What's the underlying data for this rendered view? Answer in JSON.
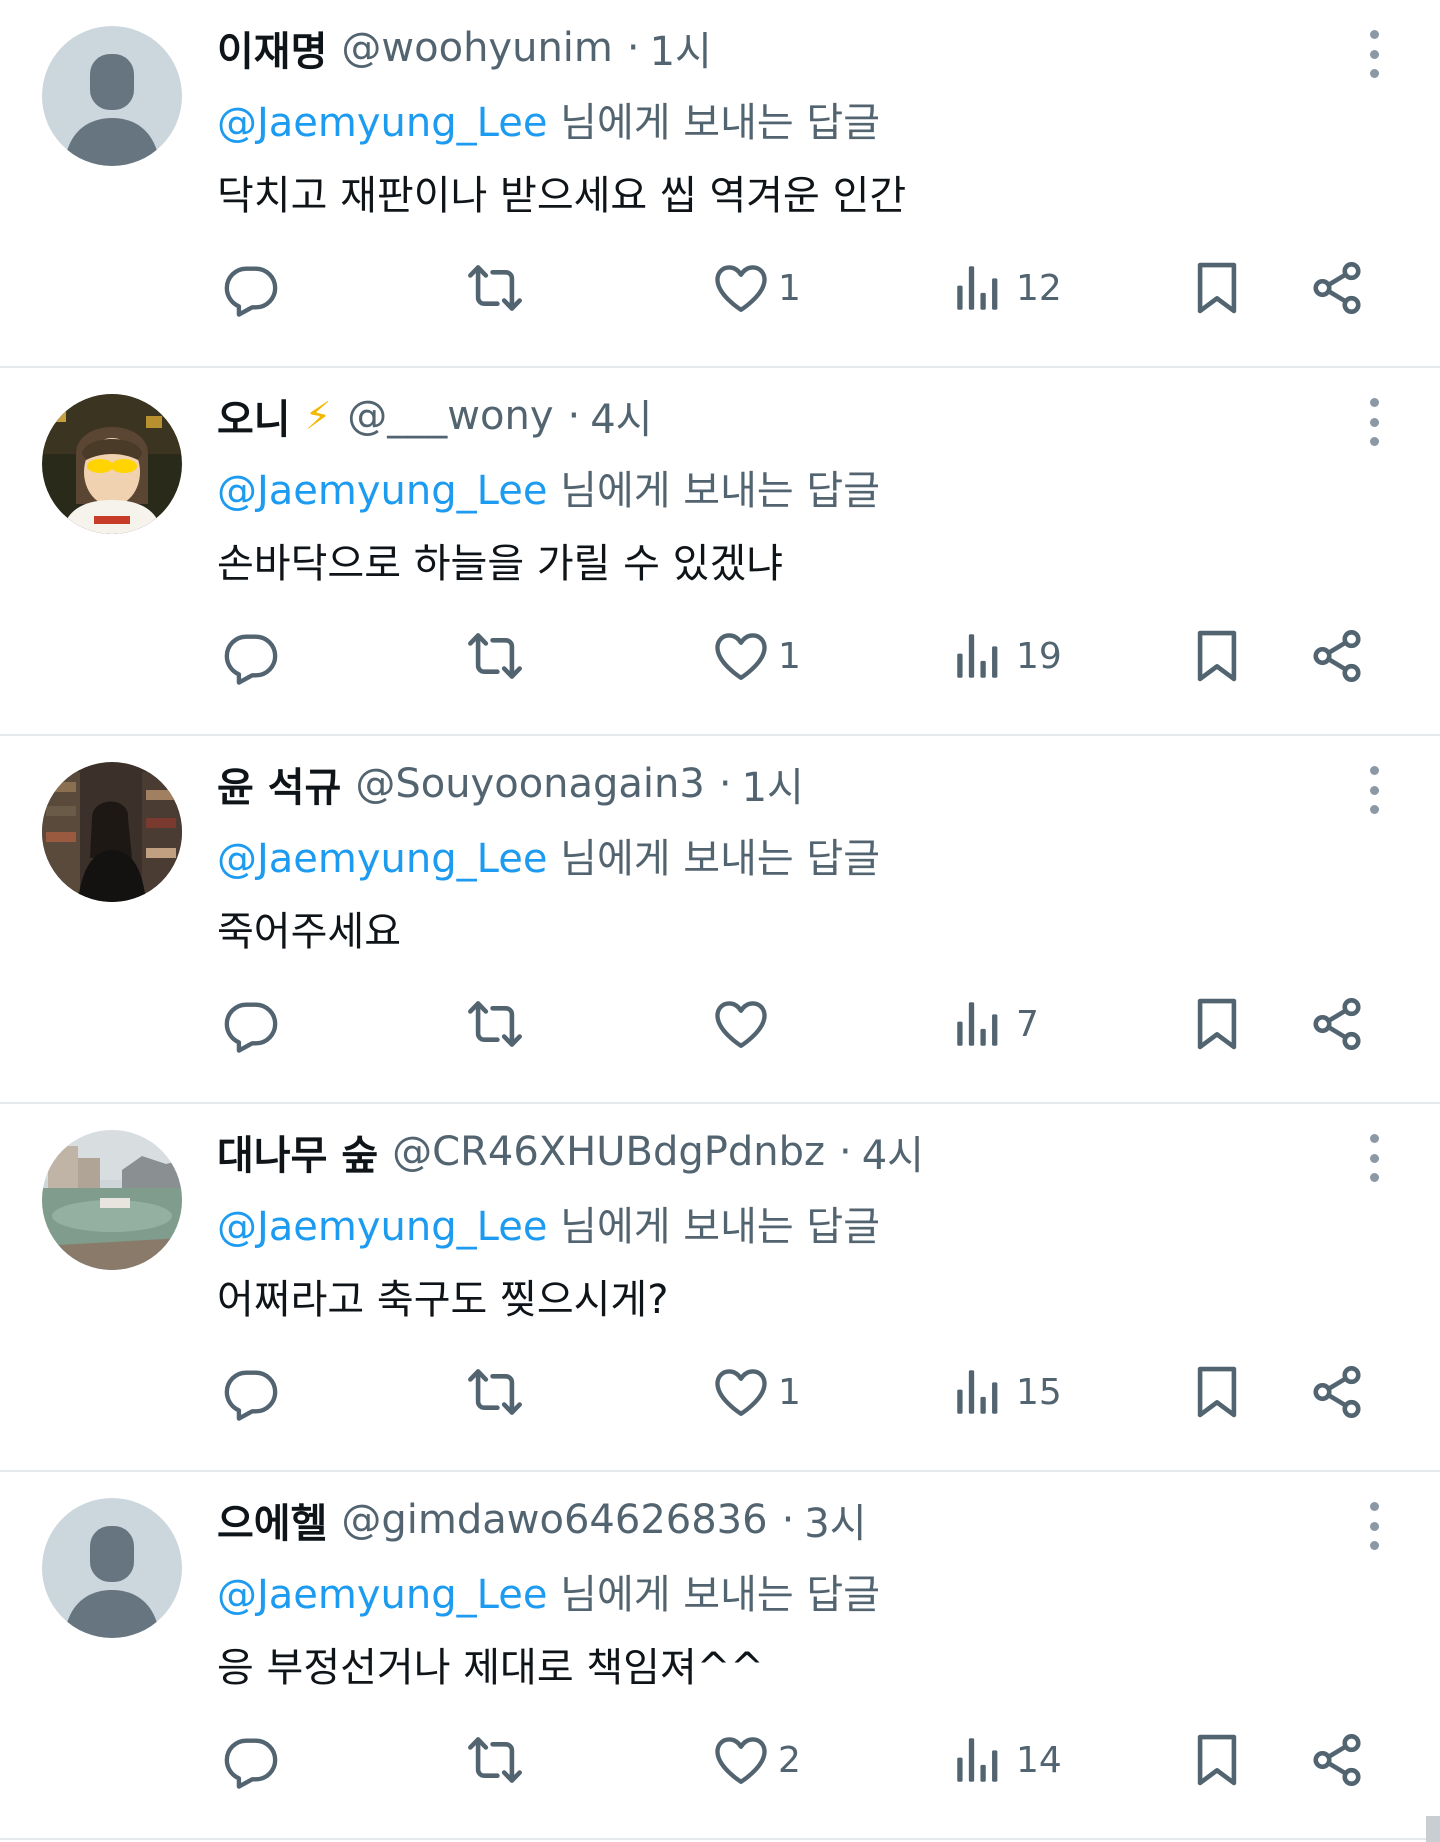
{
  "tweets": [
    {
      "name": "이재명",
      "emoji": "",
      "handle": "@woohyunim",
      "dot": "·",
      "time": "1시",
      "mention": "@Jaemyung_Lee",
      "reply_suffix": " 님에게 보내는 답글",
      "text": "닥치고 재판이나 받으세요 씹 역겨운 인간",
      "likes": "1",
      "views": "12",
      "avatar": "default"
    },
    {
      "name": "오니",
      "emoji": "⚡",
      "handle": "@___wony",
      "dot": "·",
      "time": "4시",
      "mention": "@Jaemyung_Lee",
      "reply_suffix": " 님에게 보내는 답글",
      "text": "손바닥으로 하늘을 가릴 수 있겠냐",
      "likes": "1",
      "views": "19",
      "avatar": "anime"
    },
    {
      "name": "윤 석규",
      "emoji": "",
      "handle": "@Souyoonagain3",
      "dot": "·",
      "time": "1시",
      "mention": "@Jaemyung_Lee",
      "reply_suffix": " 님에게 보내는 답글",
      "text": "죽어주세요",
      "likes": "",
      "views": "7",
      "avatar": "shelf"
    },
    {
      "name": "대나무 숲",
      "emoji": "",
      "handle": "@CR46XHUBdgPdnbz",
      "dot": "·",
      "time": "4시",
      "mention": "@Jaemyung_Lee",
      "reply_suffix": " 님에게 보내는 답글",
      "text": "어쩌라고 축구도 찢으시게?",
      "likes": "1",
      "views": "15",
      "avatar": "pool"
    },
    {
      "name": "으에헬",
      "emoji": "",
      "handle": "@gimdawo64626836",
      "dot": "·",
      "time": "3시",
      "mention": "@Jaemyung_Lee",
      "reply_suffix": " 님에게 보내는 답글",
      "text": "응 부정선거나 제대로 책임져^^",
      "likes": "2",
      "views": "14",
      "avatar": "default"
    }
  ],
  "icons": {
    "reply": "reply-icon",
    "retweet": "retweet-icon",
    "like": "heart-icon",
    "views": "views-icon",
    "bookmark": "bookmark-icon",
    "share": "share-icon",
    "more": "more-vertical-icon"
  },
  "colors": {
    "mention": "#1d9bf0",
    "secondary": "#536471",
    "divider": "#e6e9ec",
    "avatar_default_bg": "#ccd6dd",
    "avatar_default_fg": "#66757f"
  }
}
